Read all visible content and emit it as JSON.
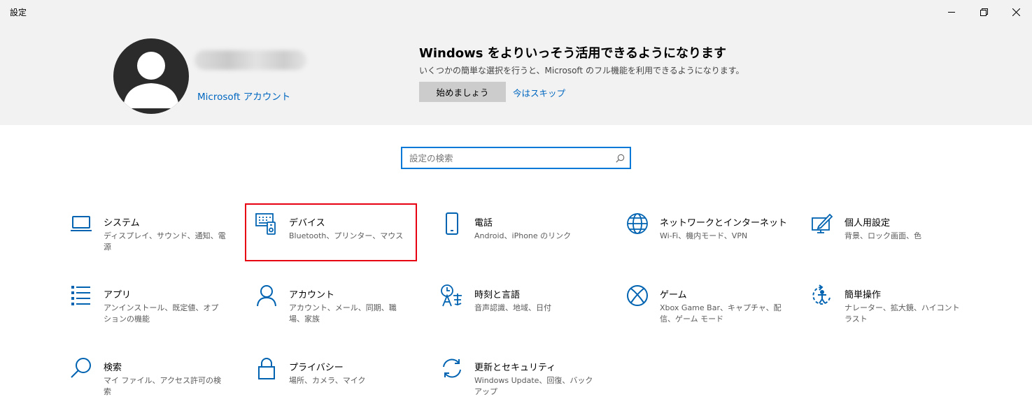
{
  "window": {
    "title": "設定",
    "controls": [
      "minimize-icon",
      "restore-icon",
      "close-icon"
    ]
  },
  "banner": {
    "account_link": "Microsoft アカウント",
    "promo_title": "Windows をよりいっそう活用できるようになります",
    "promo_subtitle": "いくつかの簡単な選択を行うと、Microsoft のフル機能を利用できるようになります。",
    "start_button": "始めましょう",
    "skip_link": "今はスキップ"
  },
  "search": {
    "placeholder": "設定の検索",
    "value": "",
    "icon": "search-icon"
  },
  "categories": [
    {
      "name": "システム",
      "desc": "ディスプレイ、サウンド、通知、電源",
      "icon": "laptop-icon"
    },
    {
      "name": "デバイス",
      "desc": "Bluetooth、プリンター、マウス",
      "icon": "keyboard-devices-icon",
      "highlighted": true
    },
    {
      "name": "電話",
      "desc": "Android、iPhone のリンク",
      "icon": "phone-icon"
    },
    {
      "name": "ネットワークとインターネット",
      "desc": "Wi-Fi、機内モード、VPN",
      "icon": "globe-icon"
    },
    {
      "name": "個人用設定",
      "desc": "背景、ロック画面、色",
      "icon": "personalization-icon"
    },
    {
      "name": "アプリ",
      "desc": "アンインストール、既定値、オプションの機能",
      "icon": "apps-list-icon"
    },
    {
      "name": "アカウント",
      "desc": "アカウント、メール、同期、職場、家族",
      "icon": "person-icon"
    },
    {
      "name": "時刻と言語",
      "desc": "音声認識、地域、日付",
      "icon": "time-language-icon"
    },
    {
      "name": "ゲーム",
      "desc": "Xbox Game Bar、キャプチャ、配信、ゲーム モード",
      "icon": "xbox-icon"
    },
    {
      "name": "簡単操作",
      "desc": "ナレーター、拡大鏡、ハイコントラスト",
      "icon": "ease-of-access-icon"
    },
    {
      "name": "検索",
      "desc": "マイ ファイル、アクセス許可の検索",
      "icon": "search-icon"
    },
    {
      "name": "プライバシー",
      "desc": "場所、カメラ、マイク",
      "icon": "lock-icon"
    },
    {
      "name": "更新とセキュリティ",
      "desc": "Windows Update、回復、バックアップ",
      "icon": "sync-icon"
    }
  ],
  "colors": {
    "accent": "#0078d7",
    "link": "#0067c0",
    "banner_bg": "#f2f2f2",
    "highlight_box": "#e60012"
  }
}
